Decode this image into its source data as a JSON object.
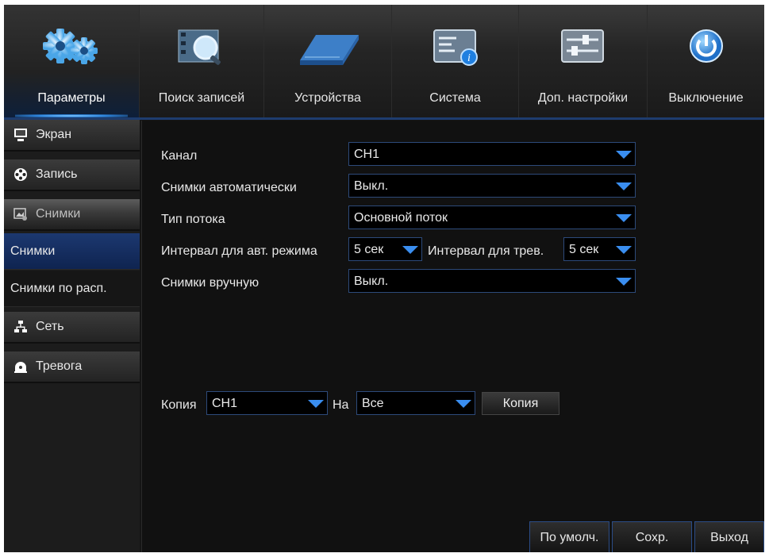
{
  "top_nav": {
    "tabs": [
      {
        "label": "Параметры",
        "icon": "gears-icon",
        "active": true
      },
      {
        "label": "Поиск записей",
        "icon": "film-search-icon",
        "active": false
      },
      {
        "label": "Устройства",
        "icon": "hard-drive-icon",
        "active": false
      },
      {
        "label": "Система",
        "icon": "system-info-icon",
        "active": false
      },
      {
        "label": "Доп. настройки",
        "icon": "sliders-icon",
        "active": false
      },
      {
        "label": "Выключение",
        "icon": "power-icon",
        "active": false
      }
    ]
  },
  "sidebar": {
    "items": [
      {
        "label": "Экран",
        "icon": "monitor-icon"
      },
      {
        "label": "Запись",
        "icon": "film-reel-icon"
      },
      {
        "label": "Снимки",
        "icon": "image-settings-icon",
        "active": true
      },
      {
        "label": "Снимки",
        "sub": true,
        "active": true
      },
      {
        "label": "Снимки по расп.",
        "sub": true
      },
      {
        "label": "Сеть",
        "icon": "network-icon"
      },
      {
        "label": "Тревога",
        "icon": "alarm-icon"
      }
    ]
  },
  "form": {
    "channel_label": "Канал",
    "channel_value": "CH1",
    "auto_snap_label": "Снимки автоматически",
    "auto_snap_value": "Выкл.",
    "stream_label": "Тип потока",
    "stream_value": "Основной поток",
    "auto_interval_label": "Интервал для авт. режима",
    "auto_interval_value": "5 сек",
    "alarm_interval_label": "Интервал для трев.",
    "alarm_interval_value": "5 сек",
    "manual_label": "Снимки вручную",
    "manual_value": "Выкл."
  },
  "copy": {
    "label": "Копия",
    "from_value": "CH1",
    "to_label": "На",
    "to_value": "Все",
    "button": "Копия"
  },
  "bottom_buttons": {
    "default": "По умолч.",
    "save": "Сохр.",
    "exit": "Выход"
  },
  "colors": {
    "accent": "#3a8ef0",
    "active_sub": "#1c3870",
    "background": "#111111"
  }
}
